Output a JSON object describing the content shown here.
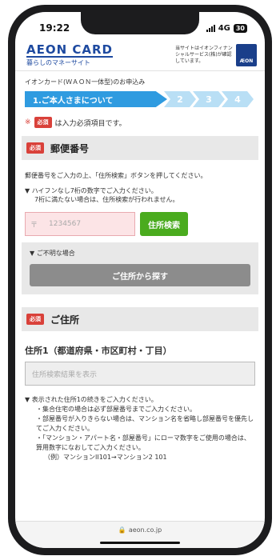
{
  "status": {
    "time": "19:22",
    "network": "4G",
    "battery": "30"
  },
  "header": {
    "logo": "AEON CARD",
    "logo_sub": "暮らしのマネーサイト",
    "certify": "当サイトはイオンフィナンシャルサービス(株)が確認しています。",
    "badge": "ÆON"
  },
  "breadcrumb": "イオンカード(ＷＡＯＮ一体型)のお申込み",
  "steps": {
    "active": "1.ご本人さまについて",
    "others": [
      "2",
      "3",
      "4"
    ]
  },
  "required": {
    "asterisk": "※",
    "badge": "必須",
    "note": "は入力必須項目です。"
  },
  "postal": {
    "title": "郵便番号",
    "badge": "必須",
    "desc": "郵便番号をご入力の上、「住所検索」ボタンを押してください。",
    "note1": "▼ ハイフンなし7桁の数字でご入力ください。",
    "note2": "7桁に満たない場合は、住所検索が行われません。",
    "symbol": "〒",
    "placeholder": "1234567",
    "search_button": "住所検索",
    "unknown_label": "▼ ご不明な場合",
    "unknown_button": "ご住所から探す"
  },
  "address": {
    "title": "ご住所",
    "badge": "必須",
    "field_label": "住所1（都道府県・市区町村・丁目）",
    "placeholder": "住所検索結果を表示",
    "notes": [
      "▼ 表示された住所1の続きをご入力ください。",
      "・集合住宅の場合は必ず部屋番号までご入力ください。",
      "・部屋番号が入りきらない場合は、マンション名を省略し部屋番号を優先してご入力ください。",
      "・「マンション・アパート名・部屋番号」にローマ数字をご使用の場合は、算用数字になおしてご入力ください。",
      "（例）マンションII101→マンション2 101"
    ]
  },
  "url": "aeon.co.jp"
}
